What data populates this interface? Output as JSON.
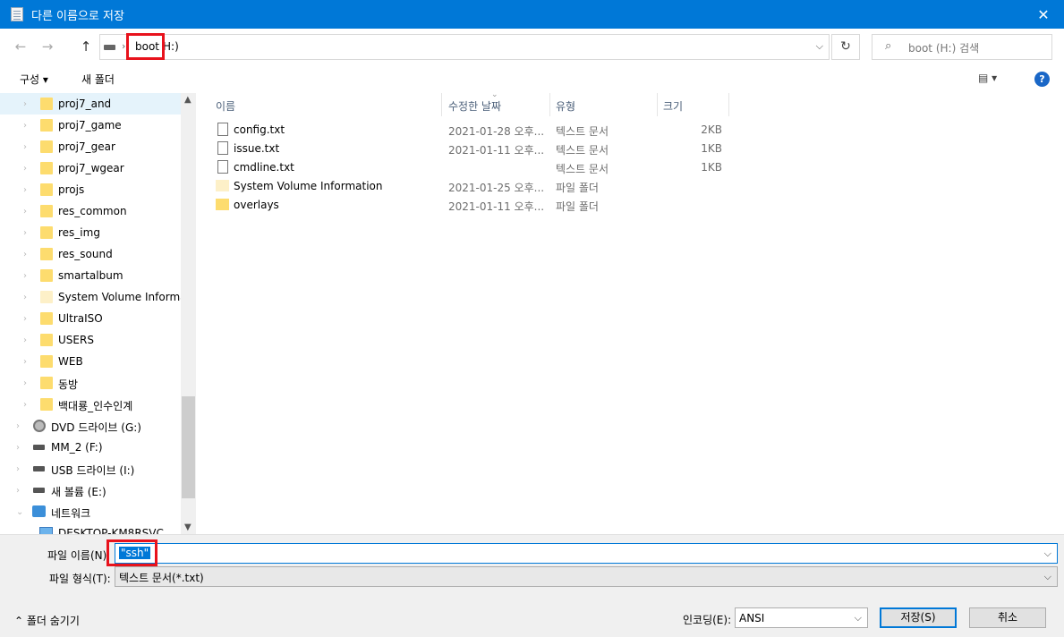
{
  "window": {
    "title": "다른 이름으로 저장",
    "close": "✕"
  },
  "address": {
    "crumb_primary": "boot",
    "crumb_secondary": "H:)",
    "separator": "›",
    "dropdown": "⌵",
    "refresh": "↻"
  },
  "nav": {
    "back": "←",
    "forward": "→",
    "up": "↑"
  },
  "search": {
    "icon": "⌕",
    "placeholder": "boot (H:) 검색"
  },
  "toolbar": {
    "organize": "구성 ▾",
    "new_folder": "새 폴더",
    "view": "▤ ▾",
    "help": "?"
  },
  "sidebar": {
    "items": [
      {
        "label": "proj7_and",
        "kind": "folder"
      },
      {
        "label": "proj7_game",
        "kind": "folder"
      },
      {
        "label": "proj7_gear",
        "kind": "folder"
      },
      {
        "label": "proj7_wgear",
        "kind": "folder"
      },
      {
        "label": "projs",
        "kind": "folder"
      },
      {
        "label": "res_common",
        "kind": "folder"
      },
      {
        "label": "res_img",
        "kind": "folder"
      },
      {
        "label": "res_sound",
        "kind": "folder"
      },
      {
        "label": "smartalbum",
        "kind": "folder"
      },
      {
        "label": "System Volume Informati",
        "kind": "folder-pale"
      },
      {
        "label": "UltraISO",
        "kind": "folder"
      },
      {
        "label": "USERS",
        "kind": "folder"
      },
      {
        "label": "WEB",
        "kind": "folder"
      },
      {
        "label": "동방",
        "kind": "folder"
      },
      {
        "label": "백대룡_인수인계",
        "kind": "folder"
      },
      {
        "label": "DVD 드라이브 (G:)",
        "kind": "dvd"
      },
      {
        "label": "MM_2 (F:)",
        "kind": "drive"
      },
      {
        "label": "USB 드라이브 (I:)",
        "kind": "drive"
      },
      {
        "label": "새 볼륨 (E:)",
        "kind": "drive"
      },
      {
        "label": "네트워크",
        "kind": "network"
      },
      {
        "label": "DESKTOP-KM8RSVC",
        "kind": "pc"
      }
    ],
    "chevron": "›",
    "chevron_open": "⌄",
    "scroll_up": "▲",
    "scroll_down": "▼"
  },
  "columns": {
    "name": "이름",
    "date": "수정한 날짜",
    "type": "유형",
    "size": "크기",
    "sort_arrow": "⌄"
  },
  "files": [
    {
      "name": "config.txt",
      "date": "2021-01-28 오후...",
      "type": "텍스트 문서",
      "size": "2KB",
      "kind": "text"
    },
    {
      "name": "issue.txt",
      "date": "2021-01-11 오후...",
      "type": "텍스트 문서",
      "size": "1KB",
      "kind": "text"
    },
    {
      "name": "cmdline.txt",
      "date": "",
      "type": "텍스트 문서",
      "size": "1KB",
      "kind": "text"
    },
    {
      "name": "System Volume Information",
      "date": "2021-01-25 오후...",
      "type": "파일 폴더",
      "size": "",
      "kind": "folder-pale"
    },
    {
      "name": "overlays",
      "date": "2021-01-11 오후...",
      "type": "파일 폴더",
      "size": "",
      "kind": "folder"
    }
  ],
  "bottom": {
    "filename_label": "파일 이름(N):",
    "filename_value": "\"ssh\"",
    "filetype_label": "파일 형식(T):",
    "filetype_value": "텍스트 문서(*.txt)",
    "dropdown": "⌵",
    "hide_folders": "⌃ 폴더 숨기기",
    "encoding_label": "인코딩(E):",
    "encoding_value": "ANSI",
    "save": "저장(S)",
    "cancel": "취소"
  },
  "colors": {
    "accent": "#0078d7",
    "highlight_box": "#e8121c",
    "folder": "#fddc6e"
  }
}
